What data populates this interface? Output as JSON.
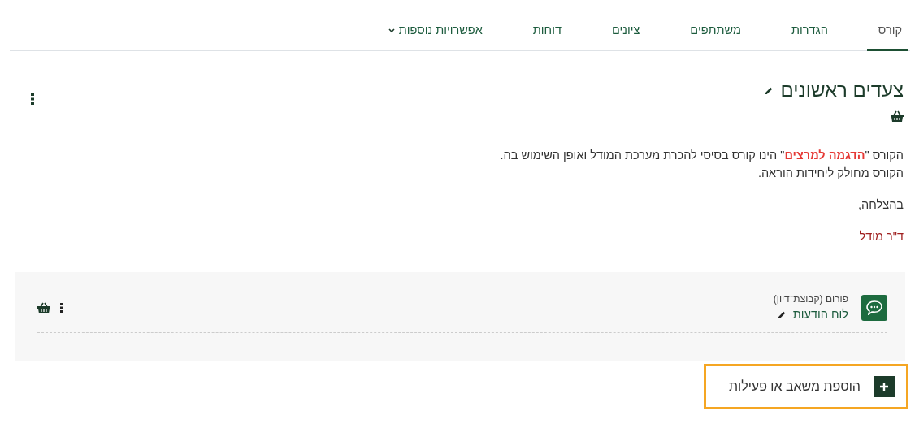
{
  "tabs": [
    {
      "label": "קורס",
      "selected": true
    },
    {
      "label": "הגדרות",
      "selected": false
    },
    {
      "label": "משתתפים",
      "selected": false
    },
    {
      "label": "ציונים",
      "selected": false
    },
    {
      "label": "דוחות",
      "selected": false
    },
    {
      "label": "אפשרויות נוספות",
      "selected": false,
      "kind": "dropdown"
    }
  ],
  "section": {
    "title": "צעדים ראשונים",
    "description": [
      "הקורס \"**הדגמה למרצים**\" הינו קורס בסיסי להכרת מערכת המודל ואופן השימוש בה.",
      "הקורס מחולק ליחידות הוראה."
    ],
    "greeting": "בהצלחה,",
    "signature": "ד\"ר מודל"
  },
  "activities": [
    {
      "type_label": "פורום (קבוצת־דיון)",
      "name": "לוח הודעות"
    }
  ],
  "add_button": {
    "label": "הוספת משאב או פעילות",
    "highlighted": true
  }
}
